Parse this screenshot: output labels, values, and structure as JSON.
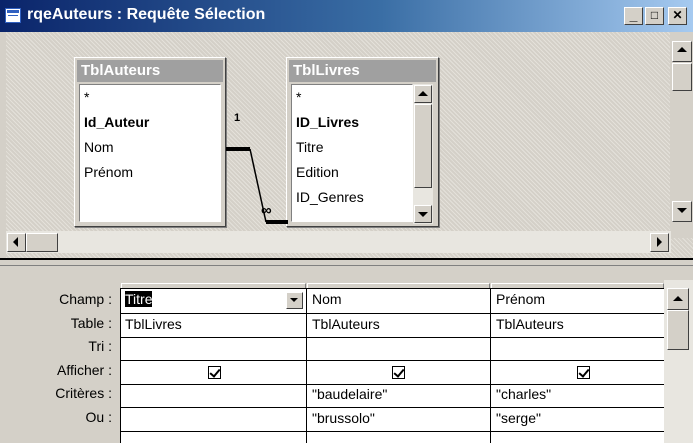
{
  "window": {
    "title": "rqeAuteurs : Requête Sélection",
    "minimize": "_",
    "restore": "□",
    "close": "✕"
  },
  "tables": [
    {
      "name": "TblAuteurs",
      "fields": [
        "*",
        "Id_Auteur",
        "Nom",
        "Prénom"
      ],
      "key_field": "Id_Auteur"
    },
    {
      "name": "TblLivres",
      "fields": [
        "*",
        "ID_Livres",
        "Titre",
        "Edition",
        "ID_Genres"
      ],
      "key_field": "ID_Livres"
    }
  ],
  "relationship": {
    "from_field": "Id_Auteur",
    "to_field": "ID_Genres",
    "one_label": "1",
    "many_label": "∞"
  },
  "grid": {
    "row_labels": [
      "Champ :",
      "Table :",
      "Tri :",
      "Afficher :",
      "Critères :",
      "Ou :"
    ],
    "columns": [
      {
        "champ": "Titre",
        "table": "TblLivres",
        "tri": "",
        "afficher": true,
        "criteres": "",
        "ou": ""
      },
      {
        "champ": "Nom",
        "table": "TblAuteurs",
        "tri": "",
        "afficher": true,
        "criteres": "\"baudelaire\"",
        "ou": "\"brussolo\""
      },
      {
        "champ": "Prénom",
        "table": "TblAuteurs",
        "tri": "",
        "afficher": true,
        "criteres": "\"charles\"",
        "ou": "\"serge\""
      }
    ]
  }
}
